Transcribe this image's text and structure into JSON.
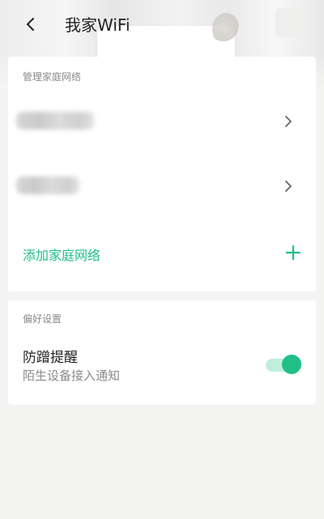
{
  "header": {
    "title": "我家WiFi"
  },
  "networks": {
    "section_title": "管理家庭网络",
    "items": [
      {
        "name": "",
        "icon": "chevron-right-icon"
      },
      {
        "name": "",
        "icon": "chevron-right-icon"
      }
    ],
    "add_label": "添加家庭网络"
  },
  "preferences": {
    "section_title": "偏好设置",
    "anti_leech": {
      "title": "防蹭提醒",
      "subtitle": "陌生设备接入通知",
      "enabled": true
    }
  },
  "colors": {
    "accent": "#1fbf86",
    "background": "#f4f4f2",
    "card": "#ffffff",
    "muted_text": "#8a8a8a"
  }
}
